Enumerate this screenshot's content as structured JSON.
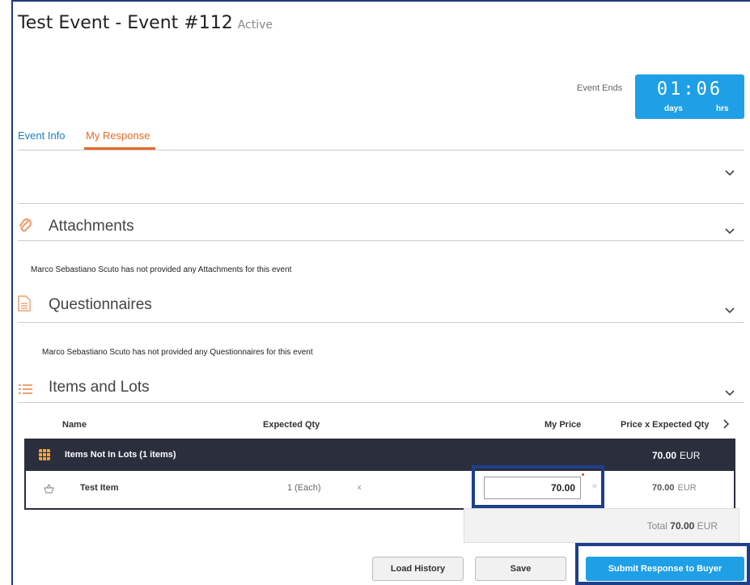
{
  "header": {
    "title": "Test Event - Event #112",
    "status": "Active"
  },
  "timer": {
    "event_ends_label": "Event Ends",
    "digits": "01:06",
    "days_label": "days",
    "hrs_label": "hrs"
  },
  "tabs": [
    {
      "label": "Event Info"
    },
    {
      "label": "My Response",
      "active": true
    }
  ],
  "sections": {
    "attachments": {
      "title": "Attachments",
      "note": "Marco Sebastiano Scuto has not provided any Attachments for this event"
    },
    "questionnaires": {
      "title": "Questionnaires",
      "note": "Marco Sebastiano Scuto has not provided any Questionnaires for this event"
    },
    "items": {
      "title": "Items and Lots"
    }
  },
  "table": {
    "headers": {
      "name": "Name",
      "expected_qty": "Expected Qty",
      "my_price": "My Price",
      "price_x_qty": "Price x Expected Qty"
    },
    "lot": {
      "name": "Items Not In Lots (1 items)",
      "amount": "70.00",
      "currency": "EUR"
    },
    "item": {
      "name": "Test Item",
      "qty": "1 (Each)",
      "times": "x",
      "price": "70.00",
      "equals": "=",
      "total_amount": "70.00",
      "total_currency": "EUR"
    },
    "total": {
      "label": "Total",
      "amount": "70.00",
      "currency": "EUR"
    }
  },
  "buttons": {
    "load_history": "Load History",
    "save": "Save",
    "submit": "Submit Response to Buyer"
  },
  "colors": {
    "accent_blue": "#1e9fe6",
    "tab_orange": "#e56a28",
    "highlight_box": "#1e3f8a",
    "lot_bar": "#2b2e3d"
  }
}
